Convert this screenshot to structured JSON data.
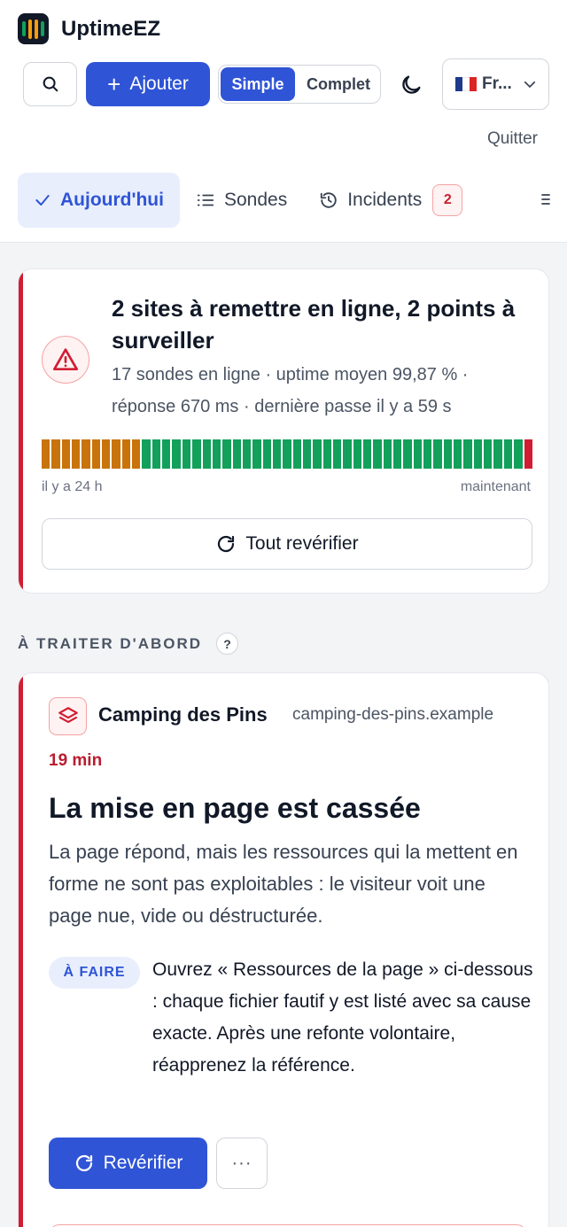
{
  "app": {
    "name": "UptimeEZ"
  },
  "toolbar": {
    "add_label": "Ajouter",
    "mode_simple": "Simple",
    "mode_complete": "Complet",
    "language": "Fr...",
    "quit": "Quitter"
  },
  "tabs": [
    {
      "label": "Aujourd'hui",
      "active": true
    },
    {
      "label": "Sondes"
    },
    {
      "label": "Incidents",
      "badge": "2"
    }
  ],
  "summary": {
    "title": "2 sites à remettre en ligne, 2 points à surveiller",
    "subtitle": "17 sondes en ligne · uptime moyen 99,87 % · réponse 670 ms · dernière passe il y a 59 s",
    "timeline_start": "il y a 24 h",
    "timeline_end": "maintenant",
    "timeline": {
      "orange_segments": 10,
      "green_segments": 38,
      "red_segments": 1
    },
    "recheck_all": "Tout revérifier"
  },
  "section": {
    "title": "À TRAITER D'ABORD",
    "help": "?"
  },
  "incident": {
    "site_name": "Camping des Pins",
    "site_url": "camping-des-pins.example",
    "duration": "19 min",
    "title": "La mise en page est cassée",
    "description": "La page répond, mais les ressources qui la mettent en forme ne sont pas exploitables : le visiteur voit une page nue, vide ou déstructurée.",
    "todo_label": "À FAIRE",
    "todo_text": "Ouvrez « Ressources de la page » ci-dessous : chaque fichier fautif y est listé avec sa cause exacte. Après une refonte volontaire, réapprenez la référence.",
    "recheck": "Revérifier",
    "more": "···"
  },
  "colors": {
    "accent": "#2f54d6",
    "danger": "#d11d33",
    "warning": "#c8730b",
    "success": "#12a05a"
  }
}
